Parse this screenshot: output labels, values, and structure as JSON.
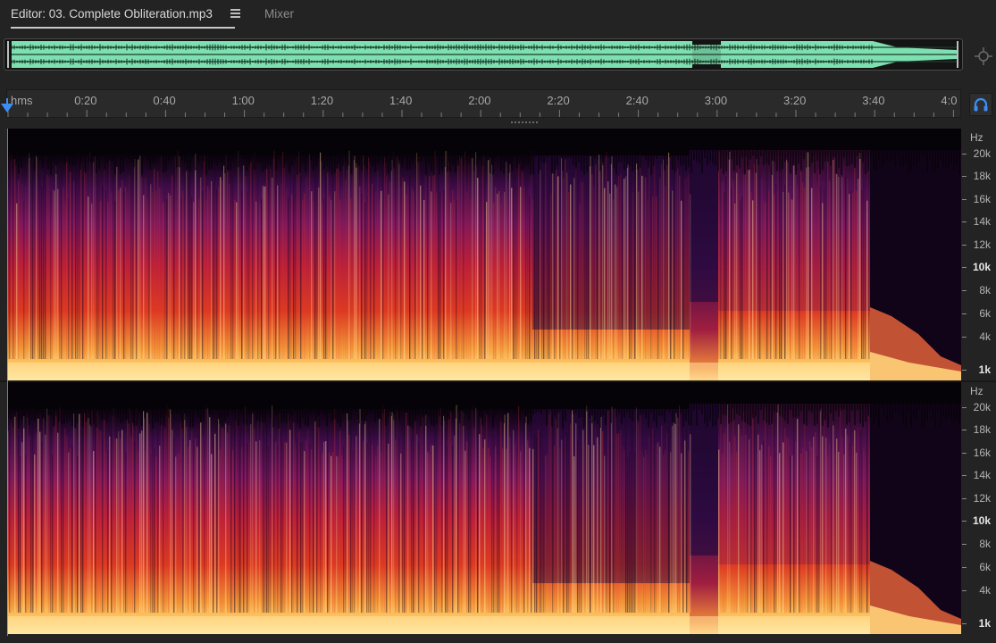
{
  "tabs": {
    "editor_label": "Editor: 03. Complete Obliteration.mp3",
    "mixer_label": "Mixer"
  },
  "ruler": {
    "unit_label": "hms",
    "labels": [
      "0:20",
      "0:40",
      "1:00",
      "1:20",
      "1:40",
      "2:00",
      "2:20",
      "2:40",
      "3:00",
      "3:20",
      "3:40",
      "4:0"
    ]
  },
  "frequency_scale": {
    "unit": "Hz",
    "labels": [
      "20k",
      "18k",
      "16k",
      "14k",
      "12k",
      "10k",
      "8k",
      "6k",
      "4k",
      "1k"
    ]
  },
  "icons": {
    "menu": "hamburger-menu-icon",
    "zoom": "zoom-navigator-icon",
    "monitor": "headphones-icon",
    "playhead": "playhead-icon"
  },
  "colors": {
    "waveform": "#7de0b0",
    "playhead": "#3d8df5",
    "spectral_low": "#2a0a3e",
    "spectral_mid": "#c6202a",
    "spectral_high": "#ffd27a"
  }
}
